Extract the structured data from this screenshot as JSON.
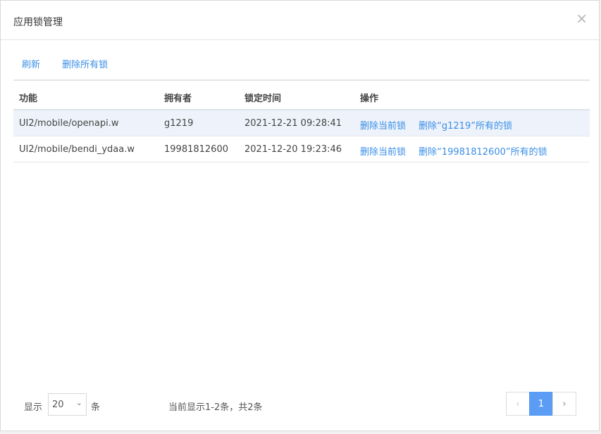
{
  "dialog": {
    "title": "应用锁管理",
    "close_icon": "close-icon"
  },
  "toolbar": {
    "refresh_label": "刷新",
    "delete_all_label": "删除所有锁"
  },
  "table": {
    "headers": [
      "功能",
      "拥有者",
      "锁定时间",
      "操作"
    ],
    "rows": [
      {
        "function": "UI2/mobile/openapi.w",
        "owner": "g1219",
        "lock_time": "2021-12-21 09:28:41",
        "action_delete_current": "删除当前锁",
        "action_delete_owner": "删除“g1219”所有的锁",
        "selected": true
      },
      {
        "function": "UI2/mobile/bendi_ydaa.w",
        "owner": "19981812600",
        "lock_time": "2021-12-20 19:23:46",
        "action_delete_current": "删除当前锁",
        "action_delete_owner": "删除“19981812600”所有的锁",
        "selected": false
      }
    ]
  },
  "footer": {
    "show_label": "显示",
    "page_size": "20",
    "unit_label": "条",
    "info": "当前显示1-2条，共2条",
    "pager": {
      "prev_icon": "chevron-left-icon",
      "current_page": "1",
      "next_icon": "chevron-right-icon"
    }
  },
  "colors": {
    "link": "#3a8ee6",
    "selected_row": "#eef3fb",
    "active_page": "#5b9cf4"
  }
}
